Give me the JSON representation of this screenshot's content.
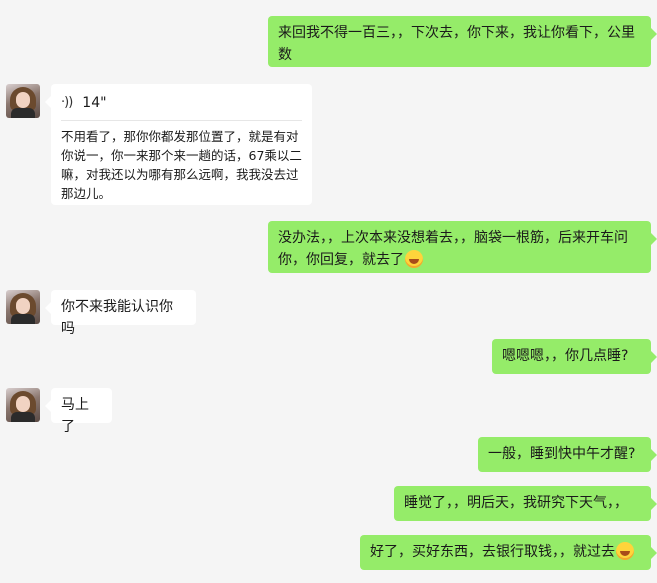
{
  "messages": [
    {
      "id": "m1",
      "side": "me",
      "text": "来回我不得一百三，，下次去，你下来，我让你看下，公里数"
    },
    {
      "id": "m2",
      "side": "other",
      "type": "voice",
      "duration": "14\"",
      "transcript": "不用看了，那你你都发那位置了，就是有对你说一，你一来那个来一趟的话，67乘以二嘛，对我还以为哪有那么远啊，我我没去过那边儿。"
    },
    {
      "id": "m3",
      "side": "me",
      "text": "没办法，，上次本来没想着去，，脑袋一根筋，后来开车问你，你回复，就去了",
      "emoji": "laughing-tears"
    },
    {
      "id": "m4",
      "side": "other",
      "text": "你不来我能认识你吗"
    },
    {
      "id": "m5",
      "side": "me",
      "text": "嗯嗯嗯，，你几点睡?"
    },
    {
      "id": "m6",
      "side": "other",
      "text": "马上了"
    },
    {
      "id": "m7",
      "side": "me",
      "text": "一般，睡到快中午才醒?"
    },
    {
      "id": "m8",
      "side": "me",
      "text": "睡觉了，，明后天，我研究下天气，，"
    },
    {
      "id": "m9",
      "side": "me",
      "text": "好了，买好东西，去银行取钱，，就过去",
      "emoji": "laughing-tears"
    }
  ],
  "colors": {
    "background": "#f5f5f5",
    "my_bubble": "#95ec69",
    "their_bubble": "#ffffff"
  },
  "icons": {
    "voice": "sound-wave-icon",
    "avatar": "contact-avatar"
  }
}
